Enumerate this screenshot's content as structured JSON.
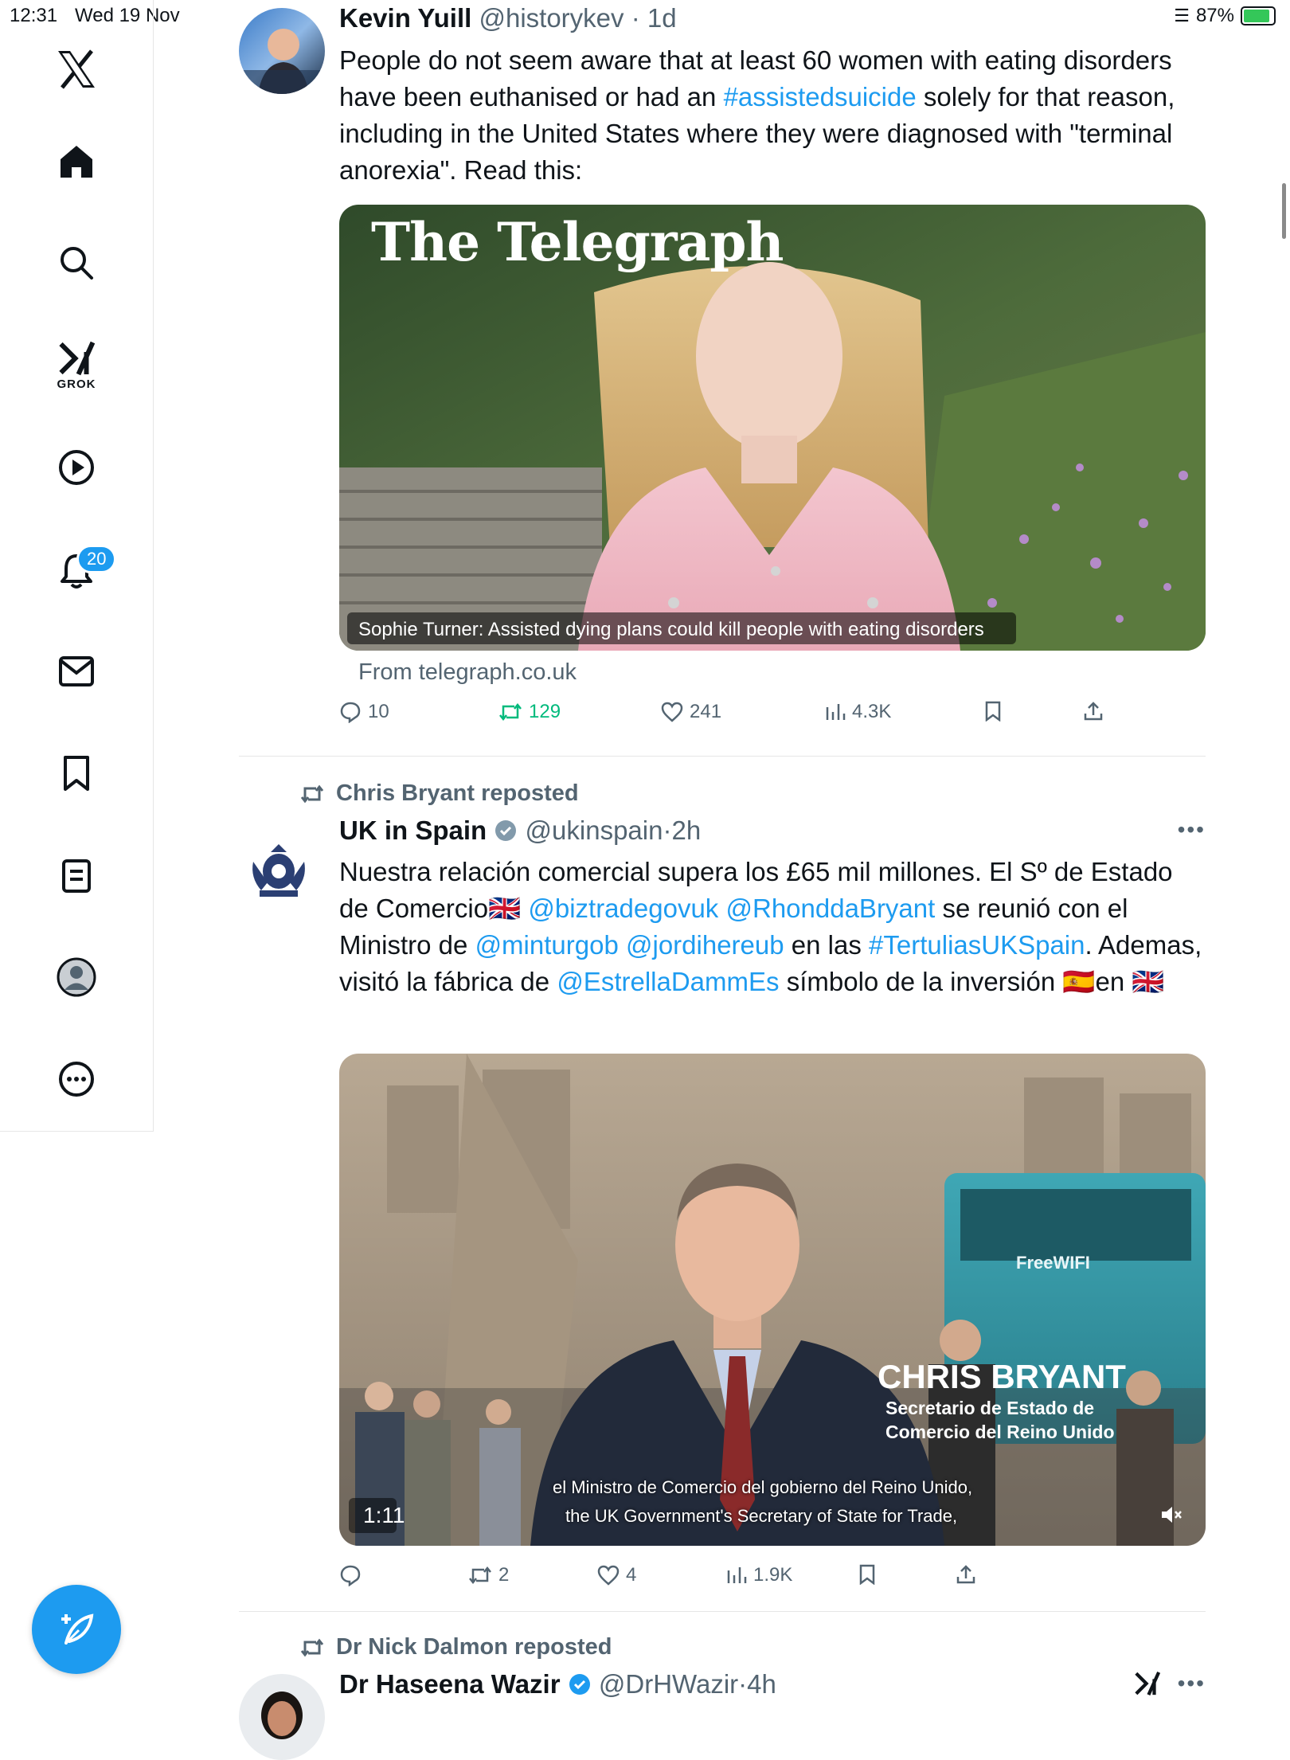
{
  "status_bar": {
    "time": "12:31",
    "date": "Wed 19 Nov",
    "battery": "87%"
  },
  "sidebar": {
    "items": [
      {
        "name": "x-logo"
      },
      {
        "name": "home"
      },
      {
        "name": "search"
      },
      {
        "name": "grok",
        "label": "GROK"
      },
      {
        "name": "video"
      },
      {
        "name": "notifications",
        "badge": "20"
      },
      {
        "name": "messages"
      },
      {
        "name": "bookmarks"
      },
      {
        "name": "lists"
      },
      {
        "name": "profile"
      },
      {
        "name": "more"
      }
    ],
    "compose_icon": "feather-plus-icon"
  },
  "tweets": [
    {
      "display_name": "Kevin Yuill",
      "handle": "@historykev",
      "time": "1d",
      "text_parts": {
        "p1": "People do not seem aware that at least 60 women with eating disorders have been euthanised or had an ",
        "hashtag": "#assistedsuicide",
        "p2": " solely for that reason, including in the United States where they were diagnosed with \"terminal anorexia\". Read this:"
      },
      "card": {
        "masthead": "The Telegraph",
        "headline": "Sophie Turner: Assisted dying plans could kill people with eating disorders",
        "source": "From telegraph.co.uk"
      },
      "stats": {
        "replies": "10",
        "reposts": "129",
        "likes": "241",
        "views": "4.3K"
      }
    },
    {
      "reposted_by": "Chris Bryant reposted",
      "display_name": "UK in Spain",
      "handle": "@ukinspain",
      "time": "2h",
      "text_parts": {
        "p1": "Nuestra relación comercial supera los £65 mil millones. El Sº de Estado de Comercio",
        "flag_uk": "🇬🇧",
        "m1": "@biztradegovuk",
        "m2": "@RhonddaBryant",
        "p2": " se reunió con el Ministro de ",
        "m3": "@minturgob",
        "m4": "@jordihereub",
        "p3": " en las ",
        "h1": "#TertuliasUKSpain",
        "p4": ". Ademas, visitó la fábrica de ",
        "m5": "@EstrellaDammEs",
        "p5": " símbolo de la inversión ",
        "flag_es": "🇪🇸",
        "p6": "en ",
        "flag_uk2": "🇬🇧"
      },
      "video": {
        "lower_third_name": "CHRIS BRYANT",
        "lower_third_title_1": "Secretario de Estado de",
        "lower_third_title_2": "Comercio del Reino Unido",
        "subtitle_es": "el Ministro de Comercio del gobierno del Reino Unido,",
        "subtitle_en": "the UK Government's Secretary of State for Trade,",
        "duration": "1:11",
        "bus_sign": "FreeWIFI"
      },
      "stats": {
        "replies": "",
        "reposts": "2",
        "likes": "4",
        "views": "1.9K"
      }
    },
    {
      "reposted_by": "Dr Nick Dalmon reposted",
      "display_name": "Dr Haseena Wazir",
      "handle": "@DrHWazir",
      "time": "4h"
    }
  ],
  "colors": {
    "accent": "#1d9bf0",
    "repost_green": "#00ba7c",
    "muted": "#536471"
  }
}
